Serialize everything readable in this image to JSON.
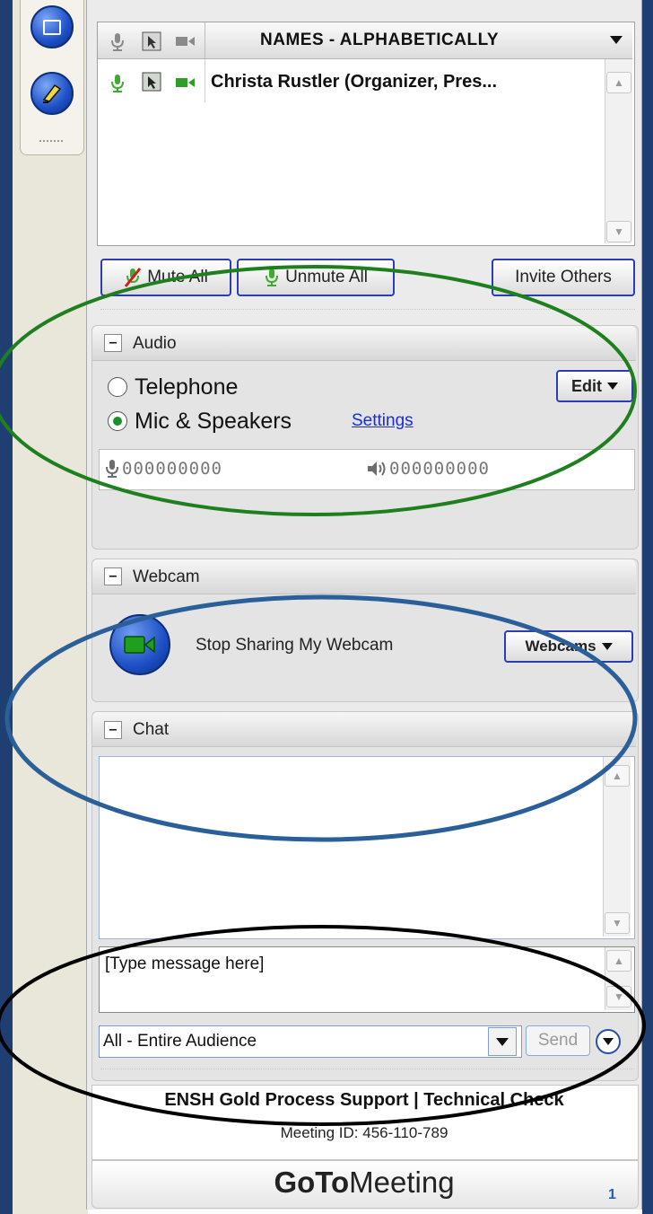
{
  "attendees": {
    "header": "NAMES - ALPHABETICALLY",
    "rows": [
      {
        "name": "Christa Rustler (Organizer, Pres..."
      }
    ]
  },
  "toolbar_buttons": {
    "mute_all": "Mute All",
    "unmute_all": "Unmute All",
    "invite_others": "Invite Others"
  },
  "audio": {
    "title": "Audio",
    "option_telephone": "Telephone",
    "option_mic": "Mic & Speakers",
    "selected": "Mic & Speakers",
    "settings_link": "Settings",
    "edit_label": "Edit",
    "mic_level": "000000000",
    "speaker_level": "000000000"
  },
  "webcam": {
    "title": "Webcam",
    "stop_label": "Stop Sharing My Webcam",
    "menu_label": "Webcams"
  },
  "chat": {
    "title": "Chat",
    "message_placeholder": "[Type message here]",
    "recipient": "All - Entire Audience",
    "send_label": "Send"
  },
  "footer": {
    "session_title": "ENSH Gold Process Support | Technical Check",
    "meeting_id": "Meeting ID: 456-110-789",
    "brand_bold": "GoTo",
    "brand_light": "Meeting"
  },
  "slide": {
    "page_number": "1"
  },
  "colors": {
    "accent_blue": "#2a3db5",
    "mic_green": "#1a8f2a",
    "annotation_green": "#1f7f1f",
    "annotation_blue": "#2b5f9a",
    "annotation_black": "#000000"
  },
  "icons": [
    "screen-share-tool-icon",
    "highlighter-tool-icon",
    "microphone-icon",
    "screen-view-icon",
    "webcam-icon",
    "dropdown-arrow-icon",
    "muted-mic-icon",
    "speaker-icon",
    "webcam-share-icon",
    "options-circle-icon"
  ]
}
